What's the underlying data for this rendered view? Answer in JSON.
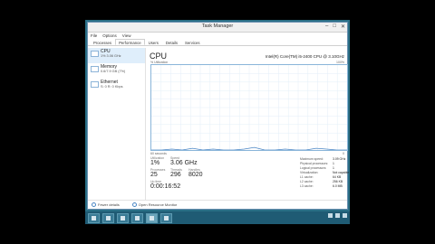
{
  "window": {
    "title": "Task Manager",
    "controls": [
      "–",
      "□",
      "✕"
    ]
  },
  "menu": [
    "File",
    "Options",
    "View"
  ],
  "tabs": [
    "Processes",
    "Performance",
    "Users",
    "Details",
    "Services"
  ],
  "sidebar": [
    {
      "name": "CPU",
      "value": "1% 3.06 GHz"
    },
    {
      "name": "Memory",
      "value": "0.6/7.9 GB (7%)"
    },
    {
      "name": "Ethernet",
      "value": "S: 0 R: 0 Kbps"
    }
  ],
  "cpu": {
    "title": "CPU",
    "model": "Intel(R) Core(TM) i5-2400 CPU @ 3.10GHz",
    "graph_label": "% Utilization",
    "graph_max": "100%",
    "axis_left": "60 seconds",
    "axis_right": "0",
    "usage_series": [
      0,
      0,
      1,
      0,
      2,
      0,
      1,
      0,
      0,
      1,
      3,
      0,
      0,
      1,
      0,
      0,
      2,
      1,
      0,
      0
    ]
  },
  "stats": {
    "utilization": {
      "label": "Utilization",
      "value": "1%"
    },
    "speed": {
      "label": "Speed",
      "value": "3.06 GHz"
    },
    "processes": {
      "label": "Processes",
      "value": "25"
    },
    "threads": {
      "label": "Threads",
      "value": "296"
    },
    "handles": {
      "label": "Handles",
      "value": "8020"
    },
    "uptime": {
      "label": "Up time",
      "value": "0:00:16:52"
    }
  },
  "specs": [
    {
      "k": "Maximum speed:",
      "v": "3.09 GHz"
    },
    {
      "k": "Physical processors:",
      "v": "1"
    },
    {
      "k": "Logical processors:",
      "v": "1"
    },
    {
      "k": "Virtualization:",
      "v": "Not capable"
    },
    {
      "k": "L1 cache:",
      "v": "64 KB"
    },
    {
      "k": "L2 cache:",
      "v": "256 KB"
    },
    {
      "k": "L3 cache:",
      "v": "6.0 MB"
    }
  ],
  "footer": {
    "fewer_details": "Fewer details",
    "open_monitor": "Open Resource Monitor"
  },
  "colors": {
    "graph_line": "#4a86c5",
    "desktop": "#2a6f86",
    "taskbar": "#1f5b74"
  }
}
